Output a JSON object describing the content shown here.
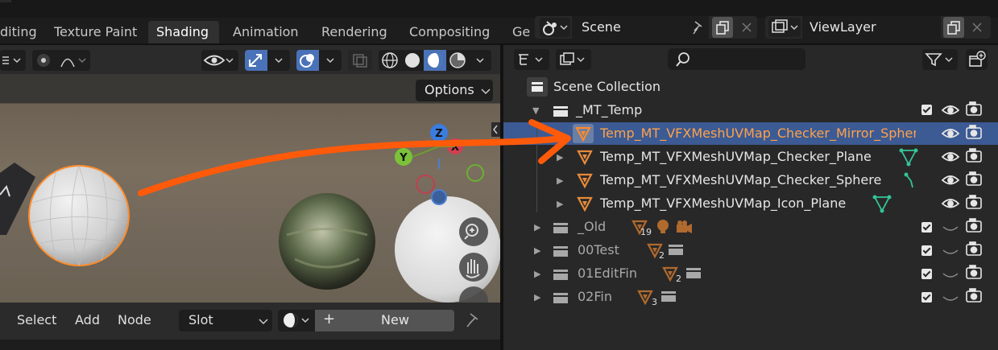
{
  "workspace_tabs": [
    "diting",
    "Texture Paint",
    "Shading",
    "Animation",
    "Rendering",
    "Compositing",
    "Ge"
  ],
  "active_tab": "Shading",
  "scene": {
    "name": "Scene"
  },
  "view_layer": {
    "name": "ViewLayer"
  },
  "viewport": {
    "options_label": "Options",
    "gizmo_axes": [
      "Z",
      "Y",
      "X"
    ]
  },
  "node_editor": {
    "menus": [
      "Select",
      "Add",
      "Node"
    ],
    "slot_label": "Slot",
    "new_label": "New",
    "plus": "+"
  },
  "outliner": {
    "search": {
      "placeholder": "",
      "value": ""
    },
    "root": "Scene Collection",
    "rows": [
      {
        "label": "_MT_Temp",
        "kind": "collection",
        "depth": 1,
        "expanded": true,
        "checked": true,
        "visible": true,
        "renderable": true
      },
      {
        "label": "Temp_MT_VFXMeshUVMap_Checker_Mirror_Sphere",
        "kind": "object",
        "depth": 2,
        "selected": true,
        "active": true
      },
      {
        "label": "Temp_MT_VFXMeshUVMap_Checker_Plane",
        "kind": "object",
        "depth": 2,
        "data_icon": "mesh-data-icon"
      },
      {
        "label": "Temp_MT_VFXMeshUVMap_Checker_Sphere",
        "kind": "object",
        "depth": 2,
        "data_icon": "mesh-vertex-icon"
      },
      {
        "label": "Temp_MT_VFXMeshUVMap_Icon_Plane",
        "kind": "object",
        "depth": 2,
        "data_icon": "mesh-data-icon"
      },
      {
        "label": "_Old",
        "kind": "collection",
        "depth": 1,
        "checked": true,
        "hidden": true,
        "badge": "19"
      },
      {
        "label": "00Test",
        "kind": "collection",
        "depth": 1,
        "checked": true,
        "hidden": true,
        "badge": "2"
      },
      {
        "label": "01EditFin",
        "kind": "collection",
        "depth": 1,
        "checked": true,
        "hidden": true,
        "badge": "2"
      },
      {
        "label": "02Fin",
        "kind": "collection",
        "depth": 1,
        "checked": true,
        "hidden": true,
        "badge": "3"
      }
    ]
  },
  "colors": {
    "accent": "#ff6a13",
    "selection": "#3c5a93",
    "object_icon": "#e88a3a",
    "panel": "#282828",
    "header": "#2b2b2b",
    "data_green": "#35c49a"
  }
}
